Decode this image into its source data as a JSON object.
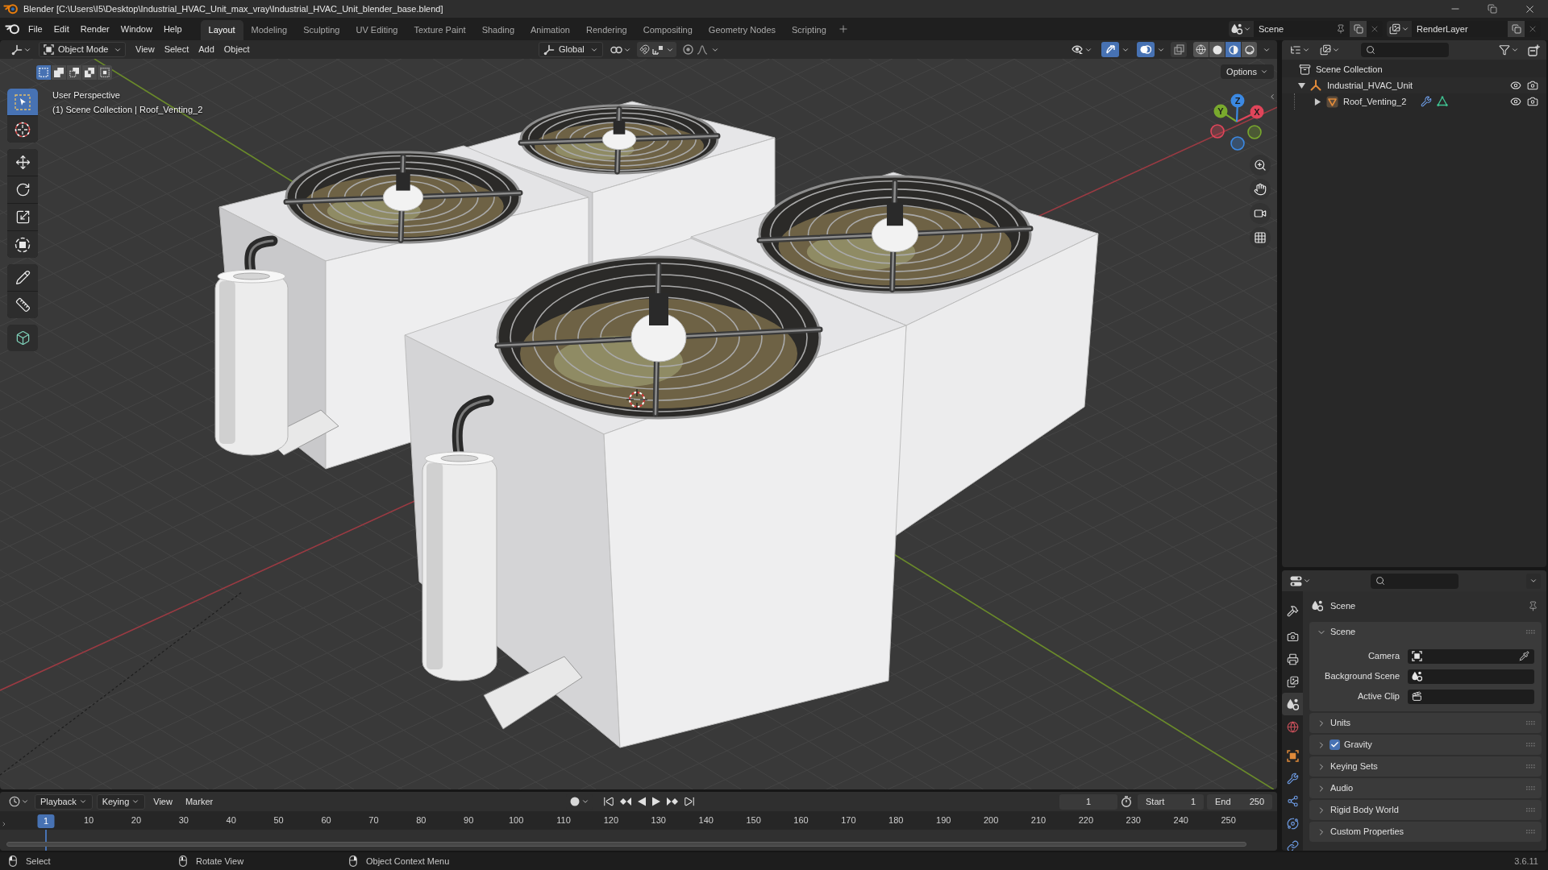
{
  "window": {
    "title": "Blender [C:\\Users\\I5\\Desktop\\Industrial_HVAC_Unit_max_vray\\Industrial_HVAC_Unit_blender_base.blend]"
  },
  "menu": [
    "File",
    "Edit",
    "Render",
    "Window",
    "Help"
  ],
  "workspaces": [
    {
      "label": "Layout",
      "selected": true
    },
    {
      "label": "Modeling",
      "selected": false
    },
    {
      "label": "Sculpting",
      "selected": false
    },
    {
      "label": "UV Editing",
      "selected": false
    },
    {
      "label": "Texture Paint",
      "selected": false
    },
    {
      "label": "Shading",
      "selected": false
    },
    {
      "label": "Animation",
      "selected": false
    },
    {
      "label": "Rendering",
      "selected": false
    },
    {
      "label": "Compositing",
      "selected": false
    },
    {
      "label": "Geometry Nodes",
      "selected": false
    },
    {
      "label": "Scripting",
      "selected": false
    }
  ],
  "scene": {
    "value": "Scene"
  },
  "view_layer": {
    "value": "RenderLayer"
  },
  "viewport_header": {
    "mode": "Object Mode",
    "menus": [
      "View",
      "Select",
      "Add",
      "Object"
    ],
    "orientation": "Global",
    "gizmos_on": true,
    "overlays_on": true,
    "xray": false,
    "shading_modes": [
      {
        "kind": "wireframe",
        "selected": false
      },
      {
        "kind": "solid",
        "selected": false
      },
      {
        "kind": "material",
        "selected": true
      },
      {
        "kind": "rendered",
        "selected": false
      }
    ]
  },
  "select_modes": [
    {
      "kind": "set",
      "selected": true
    },
    {
      "kind": "extend",
      "selected": false
    },
    {
      "kind": "subtract",
      "selected": false
    },
    {
      "kind": "difference",
      "selected": false
    },
    {
      "kind": "intersect",
      "selected": false
    }
  ],
  "tool_groups": [
    [
      {
        "kind": "select_box",
        "selected": true
      },
      {
        "kind": "cursor",
        "selected": false
      }
    ],
    [
      {
        "kind": "move",
        "selected": false
      },
      {
        "kind": "rotate",
        "selected": false
      },
      {
        "kind": "scale",
        "selected": false
      },
      {
        "kind": "transform",
        "selected": false
      }
    ],
    [
      {
        "kind": "annotate",
        "selected": false
      },
      {
        "kind": "measure",
        "selected": false
      }
    ],
    [
      {
        "kind": "add_cube",
        "selected": false
      }
    ]
  ],
  "viewport": {
    "view_name": "User Perspective",
    "context": "(1) Scene Collection | Roof_Venting_2",
    "options": "Options",
    "axes": [
      {
        "kind": "x",
        "label": "X",
        "color": "#e0455a"
      },
      {
        "kind": "y",
        "label": "Y",
        "color": "#79a92d"
      },
      {
        "kind": "z",
        "label": "Z",
        "color": "#3b89e3"
      }
    ]
  },
  "outliner": {
    "items": [
      {
        "kind": "collection",
        "label": "Scene Collection",
        "children": [
          {
            "kind": "empty",
            "label": "Industrial_HVAC_Unit",
            "expanded": true,
            "visible": true,
            "renderable": true,
            "children": [
              {
                "kind": "mesh",
                "label": "Roof_Venting_2",
                "expanded": false,
                "visible": true,
                "renderable": true
              }
            ]
          }
        ]
      }
    ]
  },
  "properties": {
    "tab_groups": [
      [
        {
          "kind": "tool",
          "selected": false
        }
      ],
      [
        {
          "kind": "render",
          "selected": false
        },
        {
          "kind": "output",
          "selected": false
        },
        {
          "kind": "view_layer",
          "selected": false
        },
        {
          "kind": "scene",
          "selected": true
        },
        {
          "kind": "world",
          "selected": false
        }
      ],
      [
        {
          "kind": "object",
          "selected": false
        },
        {
          "kind": "modifiers",
          "selected": false
        },
        {
          "kind": "particles",
          "selected": false
        },
        {
          "kind": "physics",
          "selected": false
        },
        {
          "kind": "constraints",
          "selected": false
        }
      ]
    ],
    "context": "Scene",
    "panels": [
      {
        "kind": "section",
        "title": "Scene",
        "expanded": true,
        "fields": [
          {
            "kind": "camera",
            "label": "Camera"
          },
          {
            "kind": "scene",
            "label": "Background Scene"
          },
          {
            "kind": "clip",
            "label": "Active Clip"
          }
        ]
      },
      {
        "kind": "section",
        "title": "Units",
        "expanded": false
      },
      {
        "kind": "toggle",
        "title": "Gravity",
        "expanded": false,
        "checked": true
      },
      {
        "kind": "section",
        "title": "Keying Sets",
        "expanded": false
      },
      {
        "kind": "section",
        "title": "Audio",
        "expanded": false
      },
      {
        "kind": "section",
        "title": "Rigid Body World",
        "expanded": false
      },
      {
        "kind": "section",
        "title": "Custom Properties",
        "expanded": false
      }
    ]
  },
  "timeline": {
    "menus": [
      {
        "kind": "dropdown",
        "label": "Playback"
      },
      {
        "kind": "dropdown",
        "label": "Keying"
      },
      {
        "kind": "menu",
        "label": "View"
      },
      {
        "kind": "menu",
        "label": "Marker"
      }
    ],
    "auto_keying": false,
    "current_frame": "1",
    "start_label": "Start",
    "start": "1",
    "end_label": "End",
    "end": "250",
    "playhead": "1",
    "ruler": [
      "10",
      "20",
      "30",
      "40",
      "50",
      "60",
      "70",
      "80",
      "90",
      "100",
      "110",
      "120",
      "130",
      "140",
      "150",
      "160",
      "170",
      "180",
      "190",
      "200",
      "210",
      "220",
      "230",
      "240",
      "250"
    ]
  },
  "status_bar": {
    "hints": [
      {
        "kind": "left_click",
        "label": "Select"
      },
      {
        "kind": "middle_click",
        "label": "Rotate View"
      },
      {
        "kind": "right_click",
        "label": "Object Context Menu"
      }
    ],
    "version": "3.6.11"
  }
}
